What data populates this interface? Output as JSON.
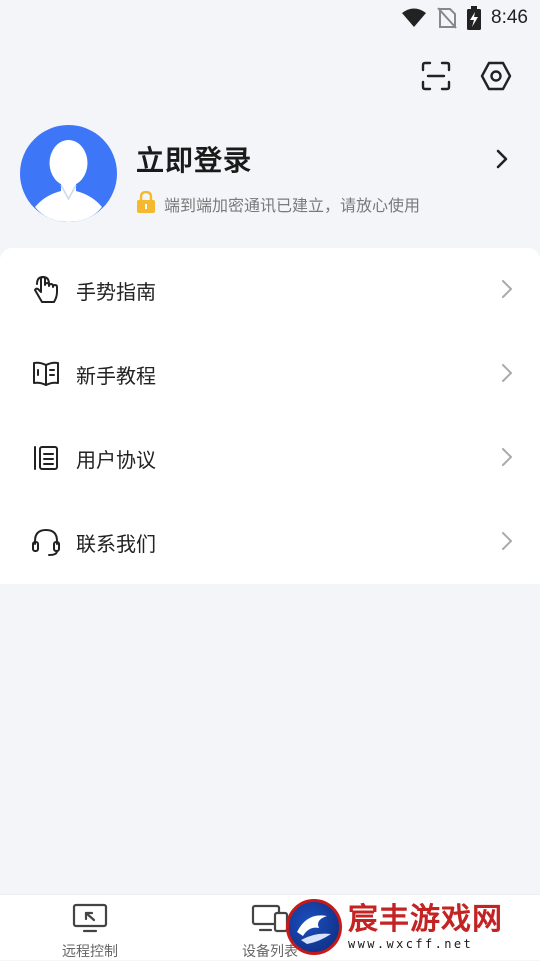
{
  "status_bar": {
    "time": "8:46"
  },
  "top_actions": {
    "scan_icon": "scan-icon",
    "settings_icon": "settings-hexagon-icon"
  },
  "profile": {
    "login_title": "立即登录",
    "secure_text": "端到端加密通讯已建立，请放心使用",
    "lock_color": "#f5b82e",
    "avatar_color": "#3d76f6"
  },
  "menu": {
    "items": [
      {
        "label": "手势指南",
        "icon": "gesture-hand-icon"
      },
      {
        "label": "新手教程",
        "icon": "book-icon"
      },
      {
        "label": "用户协议",
        "icon": "document-icon"
      },
      {
        "label": "联系我们",
        "icon": "headset-icon"
      }
    ]
  },
  "bottom_nav": {
    "items": [
      {
        "label": "远程控制",
        "icon": "remote-screen-icon"
      },
      {
        "label": "设备列表",
        "icon": "devices-icon"
      }
    ]
  },
  "watermark": {
    "title": "宸丰游戏网",
    "url": "www.wxcff.net"
  }
}
